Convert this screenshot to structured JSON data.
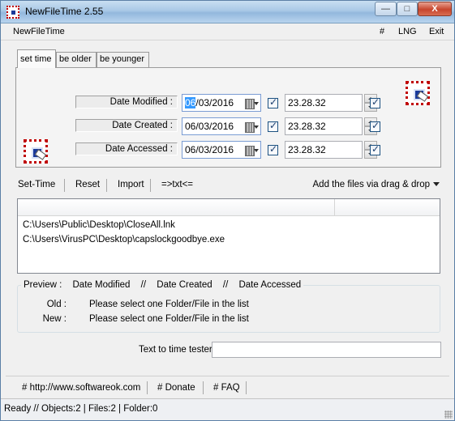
{
  "window": {
    "title": "NewFileTime 2.55",
    "minimize_label": "—",
    "maximize_label": "□",
    "close_label": "X"
  },
  "menu": {
    "app": "NewFileTime",
    "hash": "#",
    "lng": "LNG",
    "exit": "Exit"
  },
  "tabs": [
    {
      "label": "set time",
      "active": true
    },
    {
      "label": "be older",
      "active": false
    },
    {
      "label": "be younger",
      "active": false
    }
  ],
  "date_rows": [
    {
      "label": "Date Modified :",
      "date_selected": "06",
      "date_rest": "/03/2016",
      "time": "23.28.32",
      "date_checked": true,
      "time_checked": true
    },
    {
      "label": "Date Created :",
      "date_selected": "",
      "date_rest": "06/03/2016",
      "time": "23.28.32",
      "date_checked": true,
      "time_checked": true
    },
    {
      "label": "Date Accessed :",
      "date_selected": "",
      "date_rest": "06/03/2016",
      "time": "23.28.32",
      "date_checked": true,
      "time_checked": true
    }
  ],
  "toolbar": {
    "set_time": "Set-Time",
    "reset": "Reset",
    "import": "Import",
    "txt": "=>txt<=",
    "drag_drop": "Add the files via drag & drop"
  },
  "file_list": [
    "C:\\Users\\Public\\Desktop\\CloseAll.lnk",
    "C:\\Users\\VirusPC\\Desktop\\capslockgoodbye.exe"
  ],
  "preview": {
    "title_preview": "Preview  :",
    "col_modified": "Date Modified",
    "sep1": "//",
    "col_created": "Date Created",
    "sep2": "//",
    "col_accessed": "Date Accessed",
    "old_label": "Old :",
    "old_value": "Please select one Folder/File in the list",
    "new_label": "New :",
    "new_value": "Please select one Folder/File in the list"
  },
  "tester": {
    "label": "Text to time tester",
    "value": ""
  },
  "footer": {
    "website": "# http://www.softwareok.com",
    "donate": "# Donate",
    "faq": "# FAQ"
  },
  "status": {
    "text": "Ready // Objects:2 | Files:2  | Folder:0"
  },
  "colors": {
    "selection": "#3399ff",
    "close_button": "#c7452d",
    "icon_border": "#c00000"
  }
}
